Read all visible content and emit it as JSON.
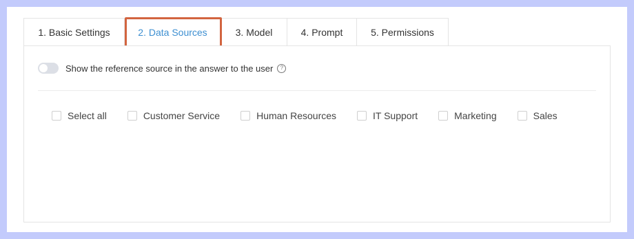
{
  "tabs": [
    {
      "label": "1. Basic Settings"
    },
    {
      "label": "2. Data Sources"
    },
    {
      "label": "3. Model"
    },
    {
      "label": "4. Prompt"
    },
    {
      "label": "5. Permissions"
    }
  ],
  "active_tab": "2. Data Sources",
  "reference_toggle": {
    "label": "Show the reference source in the answer to the user",
    "enabled": false,
    "help_icon": "question-circle-icon"
  },
  "data_sources": [
    {
      "label": "Select all",
      "checked": false
    },
    {
      "label": "Customer Service",
      "checked": false
    },
    {
      "label": "Human Resources",
      "checked": false
    },
    {
      "label": "IT Support",
      "checked": false
    },
    {
      "label": "Marketing",
      "checked": false
    },
    {
      "label": "Sales",
      "checked": false
    }
  ],
  "colors": {
    "background": "#c3cbfc",
    "active_tab": "#3d8fd1",
    "highlight": "#d2643f"
  }
}
